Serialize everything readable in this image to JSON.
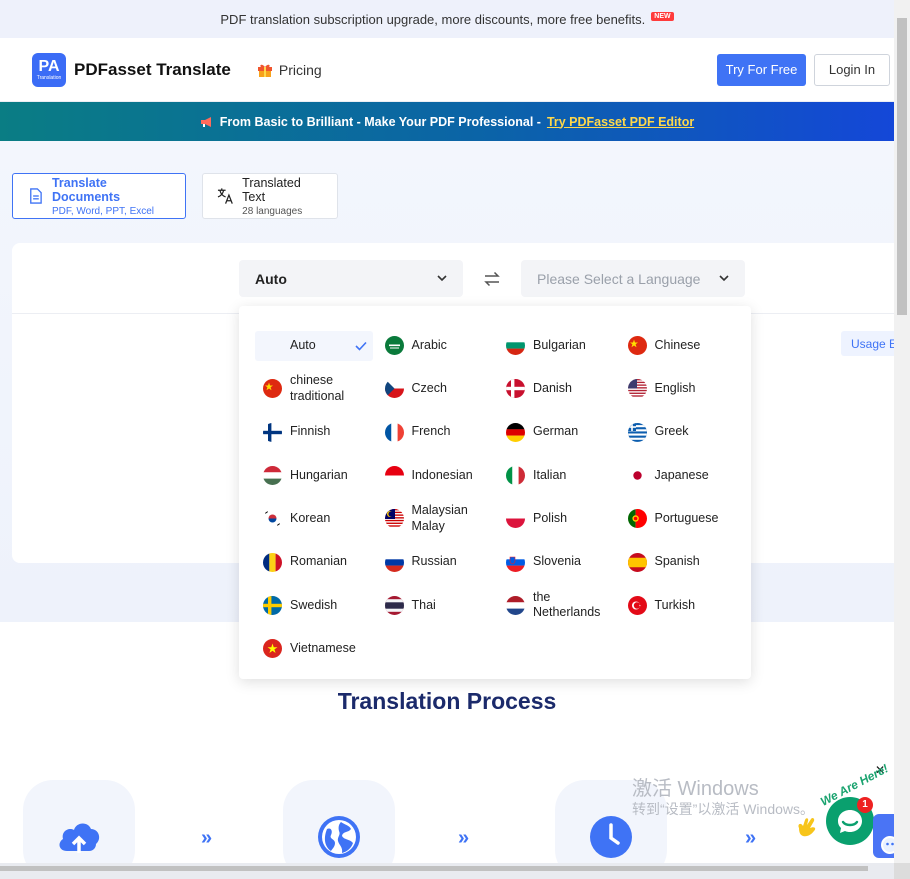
{
  "notice": {
    "text": "PDF translation subscription upgrade, more discounts, more free benefits.",
    "badge": "NEW"
  },
  "header": {
    "logo_mark": "PA",
    "logo_sub": "Translation",
    "logo_text": "PDFasset Translate",
    "pricing": "Pricing",
    "try_free": "Try For Free",
    "login": "Login In"
  },
  "promo": {
    "text": "From Basic to Brilliant - Make Your PDF Professional -",
    "link": "Try PDFasset PDF Editor"
  },
  "tabs": [
    {
      "title": "Translate Documents",
      "sub": "PDF, Word, PPT, Excel"
    },
    {
      "title": "Translated Text",
      "sub": "28 languages"
    }
  ],
  "source_lang": "Auto",
  "target_placeholder": "Please Select a Language",
  "usage": "Usage E",
  "languages": [
    {
      "name": "Auto",
      "flag": "none"
    },
    {
      "name": "Arabic",
      "flag": "sa"
    },
    {
      "name": "Bulgarian",
      "flag": "bg"
    },
    {
      "name": "Chinese",
      "flag": "cn"
    },
    {
      "name": "chinese traditional",
      "flag": "cn"
    },
    {
      "name": "Czech",
      "flag": "cz"
    },
    {
      "name": "Danish",
      "flag": "dk"
    },
    {
      "name": "English",
      "flag": "us"
    },
    {
      "name": "Finnish",
      "flag": "fi"
    },
    {
      "name": "French",
      "flag": "fr"
    },
    {
      "name": "German",
      "flag": "de"
    },
    {
      "name": "Greek",
      "flag": "gr"
    },
    {
      "name": "Hungarian",
      "flag": "hu"
    },
    {
      "name": "Indonesian",
      "flag": "id"
    },
    {
      "name": "Italian",
      "flag": "it"
    },
    {
      "name": "Japanese",
      "flag": "jp"
    },
    {
      "name": "Korean",
      "flag": "kr"
    },
    {
      "name": "Malaysian Malay",
      "flag": "my"
    },
    {
      "name": "Polish",
      "flag": "pl"
    },
    {
      "name": "Portuguese",
      "flag": "pt"
    },
    {
      "name": "Romanian",
      "flag": "ro"
    },
    {
      "name": "Russian",
      "flag": "ru"
    },
    {
      "name": "Slovenia",
      "flag": "si"
    },
    {
      "name": "Spanish",
      "flag": "es"
    },
    {
      "name": "Swedish",
      "flag": "se"
    },
    {
      "name": "Thai",
      "flag": "th"
    },
    {
      "name": "the Netherlands",
      "flag": "nl"
    },
    {
      "name": "Turkish",
      "flag": "tr"
    },
    {
      "name": "Vietnamese",
      "flag": "vn"
    }
  ],
  "process_title": "Translation Process",
  "watermark": {
    "line1": "激活 Windows",
    "line2": "转到“设置”以激活 Windows。"
  },
  "chat": {
    "badge": "1",
    "label": "We Are Here!"
  },
  "colors": {
    "primary": "#3f73f5",
    "navy": "#1b2a6b",
    "chat": "#0aa06e"
  }
}
